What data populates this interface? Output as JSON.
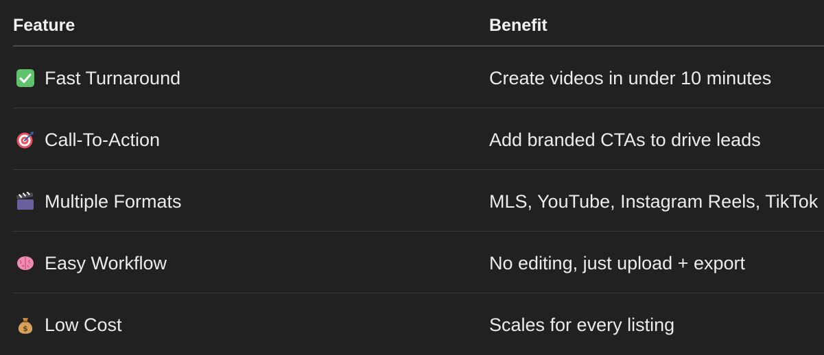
{
  "table": {
    "headers": {
      "feature": "Feature",
      "benefit": "Benefit"
    },
    "rows": [
      {
        "icon": "check-mark-button-icon",
        "feature": "Fast Turnaround",
        "benefit": "Create videos in under 10 minutes"
      },
      {
        "icon": "direct-hit-target-icon",
        "feature": "Call-To-Action",
        "benefit": "Add branded CTAs to drive leads"
      },
      {
        "icon": "clapper-board-icon",
        "feature": "Multiple Formats",
        "benefit": "MLS, YouTube, Instagram Reels, TikTok"
      },
      {
        "icon": "brain-icon",
        "feature": "Easy Workflow",
        "benefit": "No editing, just upload + export"
      },
      {
        "icon": "money-bag-icon",
        "feature": "Low Cost",
        "benefit": "Scales for every listing"
      }
    ]
  },
  "colors": {
    "background": "#212121",
    "text": "#ececec",
    "divider": "#3a3a3a",
    "header_divider": "#4a4a4a"
  }
}
